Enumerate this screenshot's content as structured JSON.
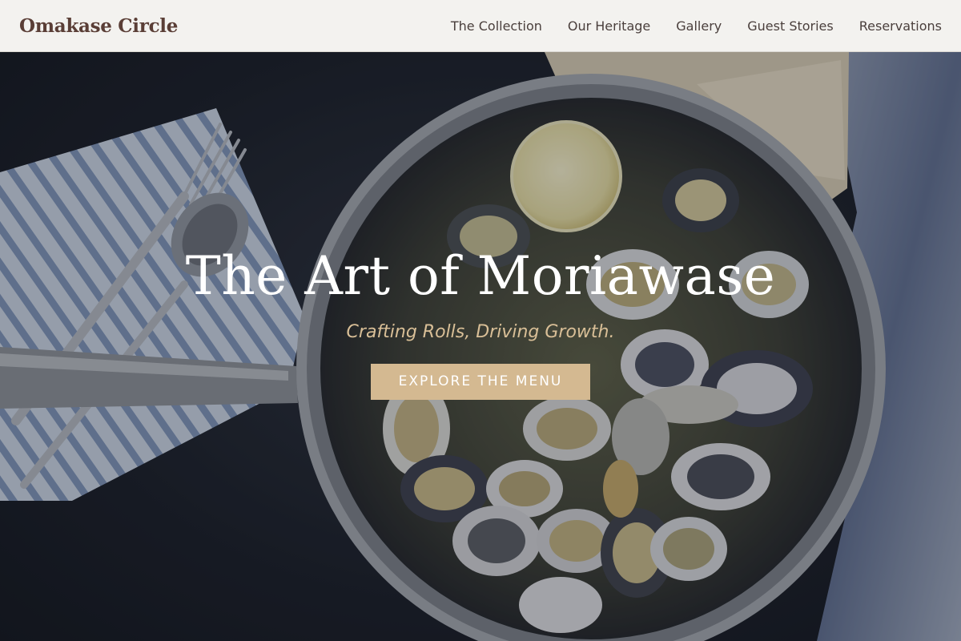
{
  "header": {
    "brand": "Omakase Circle",
    "nav": [
      {
        "label": "The Collection"
      },
      {
        "label": "Our Heritage"
      },
      {
        "label": "Gallery"
      },
      {
        "label": "Guest Stories"
      },
      {
        "label": "Reservations"
      }
    ]
  },
  "hero": {
    "title": "The Art of Moriawase",
    "subtitle": "Crafting Rolls, Driving Growth.",
    "cta_label": "EXPLORE THE MENU",
    "image_subject": "pan of clams with lemon, bread, fork, spoon and striped napkin"
  },
  "colors": {
    "header_bg": "#f3f2ef",
    "brand": "#5a3e36",
    "accent": "#d4b991",
    "subtitle": "#d9bf97"
  }
}
